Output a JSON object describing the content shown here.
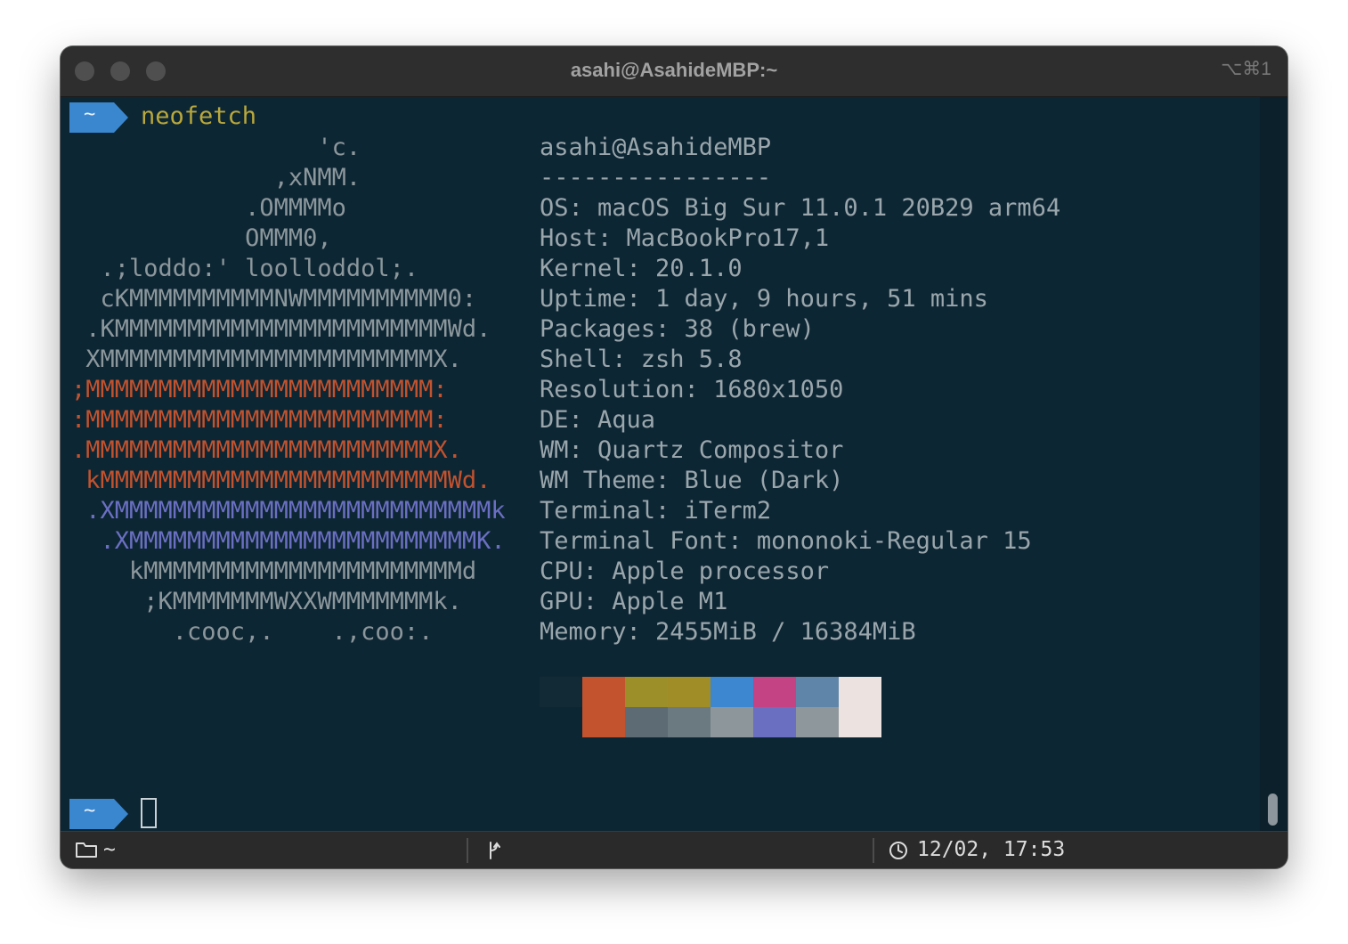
{
  "window": {
    "title": "asahi@AsahideMBP:~",
    "shortcut": "⌥⌘1"
  },
  "colors": {
    "background": "#0d2633",
    "prompt_badge": "#3a87d0",
    "command": "#b9a83c",
    "info_text": "#9aa6ac",
    "logo_gray": "#8c979c",
    "logo_orange": "#c3522e",
    "logo_blue": "#6b6fc2"
  },
  "terminal": {
    "prompt_symbol": "~",
    "command": "neofetch",
    "logo": [
      {
        "text": "                 'c.",
        "color": "#8c979c"
      },
      {
        "text": "              ,xNMM.",
        "color": "#8c979c"
      },
      {
        "text": "            .OMMMMo",
        "color": "#8c979c"
      },
      {
        "text": "            OMMM0,",
        "color": "#8c979c"
      },
      {
        "text": "  .;loddo:' loolloddol;.",
        "color": "#8c979c"
      },
      {
        "text": "  cKMMMMMMMMMMNWMMMMMMMMMM0:",
        "color": "#8c979c"
      },
      {
        "text": " .KMMMMMMMMMMMMMMMMMMMMMMMWd.",
        "color": "#8c979c"
      },
      {
        "text": " XMMMMMMMMMMMMMMMMMMMMMMMX.",
        "color": "#8c979c"
      },
      {
        "text": ";MMMMMMMMMMMMMMMMMMMMMMMM:",
        "color": "#c3522e"
      },
      {
        "text": ":MMMMMMMMMMMMMMMMMMMMMMMM:",
        "color": "#c3522e"
      },
      {
        "text": ".MMMMMMMMMMMMMMMMMMMMMMMMX.",
        "color": "#c3522e"
      },
      {
        "text": " kMMMMMMMMMMMMMMMMMMMMMMMMWd.",
        "color": "#c3522e"
      },
      {
        "text": " .XMMMMMMMMMMMMMMMMMMMMMMMMMMk",
        "color": "#6b6fc2"
      },
      {
        "text": "  .XMMMMMMMMMMMMMMMMMMMMMMMMK.",
        "color": "#6b6fc2"
      },
      {
        "text": "    kMMMMMMMMMMMMMMMMMMMMMMd",
        "color": "#8c979c"
      },
      {
        "text": "     ;KMMMMMMMWXXWMMMMMMMk.",
        "color": "#8c979c"
      },
      {
        "text": "       .cooc,.    .,coo:.",
        "color": "#8c979c"
      }
    ],
    "info_lines": [
      "asahi@AsahideMBP",
      "----------------",
      "OS: macOS Big Sur 11.0.1 20B29 arm64",
      "Host: MacBookPro17,1",
      "Kernel: 20.1.0",
      "Uptime: 1 day, 9 hours, 51 mins",
      "Packages: 38 (brew)",
      "Shell: zsh 5.8",
      "Resolution: 1680x1050",
      "DE: Aqua",
      "WM: Quartz Compositor",
      "WM Theme: Blue (Dark)",
      "Terminal: iTerm2",
      "Terminal Font: mononoki-Regular 15",
      "CPU: Apple processor",
      "GPU: Apple M1",
      "Memory: 2455MiB / 16384MiB"
    ],
    "palette_top": [
      "#112a36",
      "#c3522e",
      "#9c8f2a",
      "#a08d27",
      "#3c87cf",
      "#c34385",
      "#5f86a8",
      "#ece2e0"
    ],
    "palette_bottom": [
      "#0d2633",
      "#c3522e",
      "#5c6b74",
      "#6a7a80",
      "#8d979b",
      "#6b6fc2",
      "#8e989c",
      "#ece2e0"
    ]
  },
  "statusbar": {
    "folder_label": "~",
    "datetime": "12/02, 17:53"
  }
}
